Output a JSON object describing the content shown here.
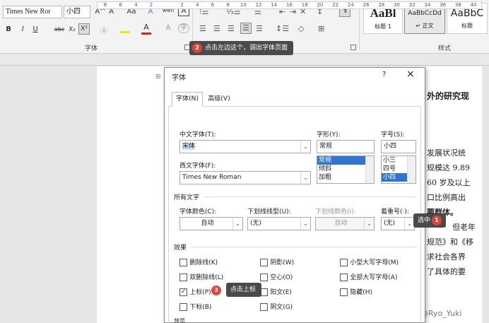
{
  "ribbon": {
    "font_name": "Times New Ror",
    "font_size": "小四",
    "font_group_label": "字体",
    "styles_group_label": "样式",
    "style_items": [
      {
        "preview": "AaBl",
        "name": "标题 1"
      },
      {
        "preview": "AaBbCcDd",
        "name": "↵ 正文"
      },
      {
        "preview": "AaBbC",
        "name": "标题"
      }
    ],
    "buttons": {
      "bold": "B",
      "italic": "I",
      "underline": "U",
      "strike": "abc",
      "subscript": "X₂",
      "superscript": "X²",
      "grow": "A^",
      "shrink": "Aˇ",
      "case": "Aa",
      "clear": "A",
      "pinyin": "wén",
      "border_char": "A"
    }
  },
  "tooltips": {
    "t2": "点击左边这个，调出字体页面",
    "t1": "选中",
    "t3": "点击上标"
  },
  "badges": {
    "b1": "1",
    "b2": "2",
    "b3": "3"
  },
  "document": {
    "lines": [
      "外的研究现",
      "发展状况统",
      "规模达 9.89",
      "60 岁及以上",
      "口比例高出",
      "要群体。",
      "但老年",
      "规范》和《移",
      "求社会各界",
      "了具体的要"
    ]
  },
  "dialog": {
    "title": "字体",
    "help": "?",
    "close": "×",
    "tabs": [
      "字体(N)",
      "高级(V)"
    ],
    "cn_font_label": "中文字体(T):",
    "cn_font_value": "宋体",
    "west_font_label": "西文字体(F):",
    "west_font_value": "Times New Roman",
    "style_label": "字形(Y):",
    "style_value": "常规",
    "style_options": [
      "常规",
      "倾斜",
      "加粗"
    ],
    "size_label": "字号(S):",
    "size_value": "小四",
    "size_options": [
      "小三",
      "四号",
      "小四"
    ],
    "all_text_label": "所有文字",
    "color_label": "字体颜色(C):",
    "color_value": "自动",
    "underline_label": "下划线线型(U):",
    "underline_value": "(无)",
    "ul_color_label": "下划线颜色(I):",
    "ul_color_value": "自动",
    "emph_label": "着重号(·):",
    "emph_value": "(无)",
    "effects_label": "效果",
    "effects": [
      {
        "label": "删除线(K)",
        "checked": false
      },
      {
        "label": "阴影(W)",
        "checked": false
      },
      {
        "label": "小型大写字母(M)",
        "checked": false
      },
      {
        "label": "双删除线(L)",
        "checked": false
      },
      {
        "label": "空心(O)",
        "checked": false
      },
      {
        "label": "全部大写字母(A)",
        "checked": false
      },
      {
        "label": "上标(P)",
        "checked": true
      },
      {
        "label": "阳文(E)",
        "checked": false
      },
      {
        "label": "隐藏(H)",
        "checked": false
      },
      {
        "label": "下标(B)",
        "checked": false
      },
      {
        "label": "阴文(G)",
        "checked": false
      }
    ],
    "preview_label": "预览"
  },
  "watermark": "CSDN @Ryo_Yuki",
  "ruler_ticks": [
    "8",
    "6",
    "4",
    "2",
    "",
    "2",
    "4",
    "6",
    "8",
    "10",
    "12",
    "14",
    "16",
    "18",
    "20",
    "22",
    "24",
    "26",
    "28",
    "30",
    "32",
    "34",
    "36",
    "38",
    "40"
  ]
}
